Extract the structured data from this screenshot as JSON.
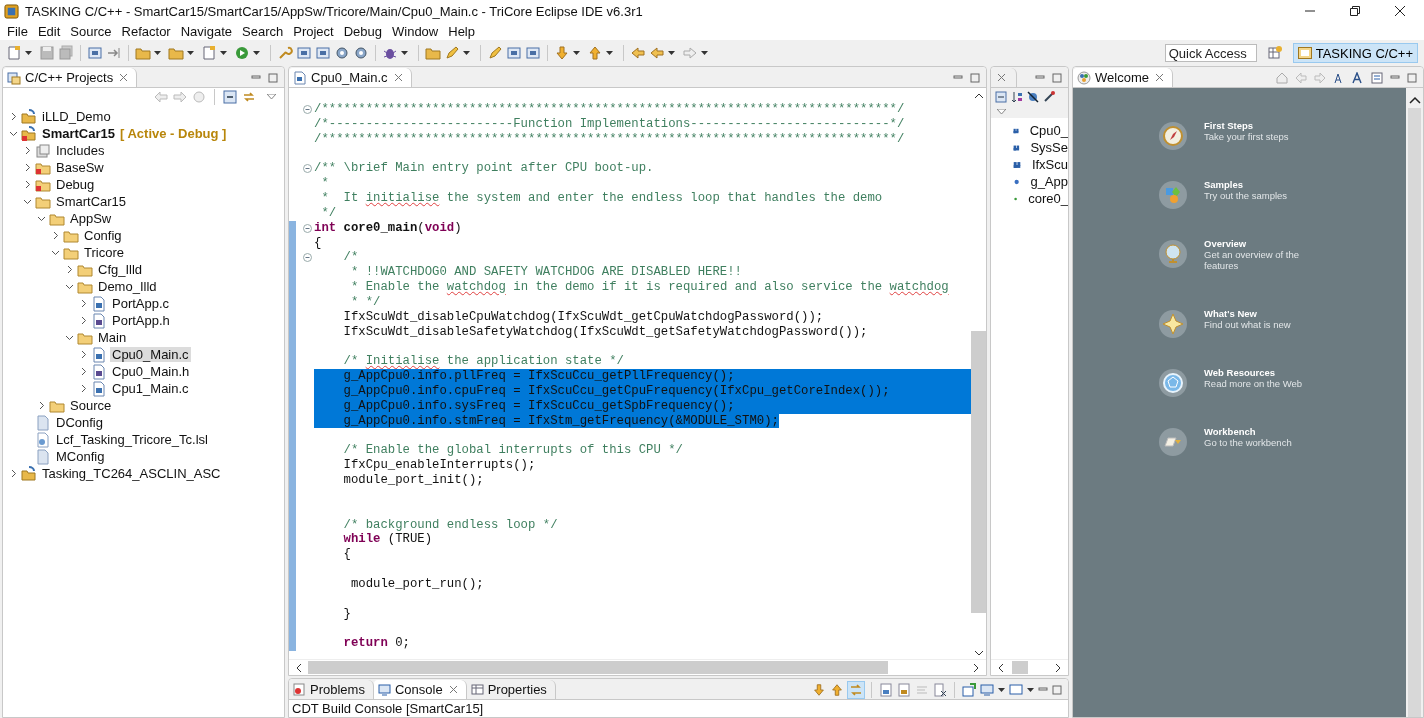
{
  "window": {
    "title": "TASKING C/C++ - SmartCar15/SmartCar15/AppSw/Tricore/Main/Cpu0_Main.c - TriCore Eclipse IDE v6.3r1"
  },
  "menu": [
    "File",
    "Edit",
    "Source",
    "Refactor",
    "Navigate",
    "Search",
    "Project",
    "Debug",
    "Window",
    "Help"
  ],
  "quick_access": {
    "placeholder": "Quick Access"
  },
  "perspectives": [
    {
      "label": "TASKING C/C++",
      "selected": true
    }
  ],
  "project_explorer": {
    "title": "C/C++ Projects",
    "tree": [
      {
        "label": "iLLD_Demo",
        "kind": "project",
        "expanded": false,
        "selected": false
      },
      {
        "label": "SmartCar15",
        "suffix": "[ Active - Debug ]",
        "kind": "project-error",
        "expanded": true,
        "selected": false,
        "children": [
          {
            "label": "Includes",
            "kind": "includes",
            "expanded": false,
            "selected": false
          },
          {
            "label": "BaseSw",
            "kind": "folder-error",
            "expanded": false,
            "selected": false
          },
          {
            "label": "Debug",
            "kind": "folder-error",
            "expanded": false,
            "selected": false
          },
          {
            "label": "SmartCar15",
            "kind": "folder",
            "expanded": true,
            "selected": false,
            "children": [
              {
                "label": "AppSw",
                "kind": "folder",
                "expanded": true,
                "selected": false,
                "children": [
                  {
                    "label": "Config",
                    "kind": "folder",
                    "expanded": false,
                    "selected": false
                  },
                  {
                    "label": "Tricore",
                    "kind": "folder",
                    "expanded": true,
                    "selected": false,
                    "children": [
                      {
                        "label": "Cfg_Illd",
                        "kind": "folder",
                        "expanded": false,
                        "selected": false
                      },
                      {
                        "label": "Demo_Illd",
                        "kind": "folder",
                        "expanded": true,
                        "selected": false,
                        "children": [
                          {
                            "label": "PortApp.c",
                            "kind": "c-file",
                            "expanded": false,
                            "selected": false
                          },
                          {
                            "label": "PortApp.h",
                            "kind": "h-file",
                            "expanded": false,
                            "selected": false
                          }
                        ]
                      },
                      {
                        "label": "Main",
                        "kind": "folder",
                        "expanded": true,
                        "selected": false,
                        "children": [
                          {
                            "label": "Cpu0_Main.c",
                            "kind": "c-file",
                            "expanded": false,
                            "selected": true
                          },
                          {
                            "label": "Cpu0_Main.h",
                            "kind": "h-file",
                            "expanded": false,
                            "selected": false
                          },
                          {
                            "label": "Cpu1_Main.c",
                            "kind": "c-file",
                            "expanded": false,
                            "selected": false
                          }
                        ]
                      }
                    ]
                  }
                ]
              },
              {
                "label": "Source",
                "kind": "folder",
                "expanded": false,
                "selected": false
              }
            ]
          },
          {
            "label": "DConfig",
            "kind": "file",
            "selected": false
          },
          {
            "label": "Lcf_Tasking_Tricore_Tc.lsl",
            "kind": "linker-file",
            "selected": false
          },
          {
            "label": "MConfig",
            "kind": "file",
            "selected": false
          }
        ]
      },
      {
        "label": "Tasking_TC264_ASCLIN_ASC",
        "kind": "project",
        "expanded": false,
        "selected": false
      }
    ]
  },
  "editor": {
    "tab": {
      "label": "Cpu0_Main.c",
      "selected": true
    },
    "lines": [
      {
        "selected": false,
        "fold": true,
        "in_range": false,
        "segments": [
          {
            "text": "/******************************************************************************/",
            "kind": "comment"
          }
        ]
      },
      {
        "selected": false,
        "fold": false,
        "in_range": false,
        "segments": [
          {
            "text": "/*-------------------------Function Implementations---------------------------*/",
            "kind": "comment"
          }
        ]
      },
      {
        "selected": false,
        "fold": false,
        "in_range": false,
        "segments": [
          {
            "text": "/******************************************************************************/",
            "kind": "comment"
          }
        ]
      },
      {
        "selected": false,
        "fold": false,
        "in_range": false
      },
      {
        "selected": false,
        "fold": true,
        "in_range": false,
        "segments": [
          {
            "text": "/** \\brief Main entry point after CPU boot-up.",
            "kind": "comment"
          }
        ]
      },
      {
        "selected": false,
        "fold": false,
        "in_range": false,
        "segments": [
          {
            "text": " *",
            "kind": "comment"
          }
        ]
      },
      {
        "selected": false,
        "fold": false,
        "in_range": false,
        "segments": [
          {
            "text": " *  It ",
            "kind": "comment"
          },
          {
            "text": "initialise",
            "kind": "misspelled"
          },
          {
            "text": " the system and enter the endless loop that handles the demo",
            "kind": "comment"
          }
        ]
      },
      {
        "selected": false,
        "fold": false,
        "in_range": false,
        "segments": [
          {
            "text": " */",
            "kind": "comment"
          }
        ]
      },
      {
        "selected": false,
        "fold": true,
        "in_range": true,
        "segments": [
          {
            "text": "int",
            "kind": "keyword"
          },
          {
            "text": " core0_main",
            "kind": "bold"
          },
          {
            "text": "(",
            "kind": "plain"
          },
          {
            "text": "void",
            "kind": "keyword"
          },
          {
            "text": ")",
            "kind": "plain"
          }
        ]
      },
      {
        "selected": false,
        "fold": false,
        "in_range": true,
        "segments": [
          {
            "text": "{",
            "kind": "plain"
          }
        ]
      },
      {
        "selected": false,
        "fold": true,
        "in_range": true,
        "segments": [
          {
            "text": "    /*",
            "kind": "comment"
          }
        ]
      },
      {
        "selected": false,
        "fold": false,
        "in_range": true,
        "segments": [
          {
            "text": "     * !!WATCHDOG0 AND SAFETY WATCHDOG ARE DISABLED HERE!!",
            "kind": "comment"
          }
        ]
      },
      {
        "selected": false,
        "fold": false,
        "in_range": true,
        "segments": [
          {
            "text": "     * Enable the ",
            "kind": "comment"
          },
          {
            "text": "watchdog",
            "kind": "misspelled"
          },
          {
            "text": " in the demo if it is required and also service the ",
            "kind": "comment"
          },
          {
            "text": "watchdog",
            "kind": "misspelled"
          }
        ]
      },
      {
        "selected": false,
        "fold": false,
        "in_range": true,
        "segments": [
          {
            "text": "     * */",
            "kind": "comment"
          }
        ]
      },
      {
        "selected": false,
        "fold": false,
        "in_range": true,
        "segments": [
          {
            "text": "    IfxScuWdt_disableCpuWatchdog(IfxScuWdt_getCpuWatchdogPassword());",
            "kind": "plain"
          }
        ]
      },
      {
        "selected": false,
        "fold": false,
        "in_range": true,
        "segments": [
          {
            "text": "    IfxScuWdt_disableSafetyWatchdog(IfxScuWdt_getSafetyWatchdogPassword());",
            "kind": "plain"
          }
        ]
      },
      {
        "selected": false,
        "fold": false,
        "in_range": true
      },
      {
        "selected": false,
        "fold": false,
        "in_range": true,
        "segments": [
          {
            "text": "    /* ",
            "kind": "comment"
          },
          {
            "text": "Initialise",
            "kind": "misspelled"
          },
          {
            "text": " the application state */",
            "kind": "comment"
          }
        ]
      },
      {
        "selected": true,
        "fold": false,
        "in_range": true,
        "segments": [
          {
            "text": "    g_AppCpu0.info.pllFreq = IfxScuCcu_getPllFrequency();",
            "kind": "plain"
          }
        ]
      },
      {
        "selected": true,
        "fold": false,
        "in_range": true,
        "segments": [
          {
            "text": "    g_AppCpu0.info.cpuFreq = IfxScuCcu_getCpuFrequency(IfxCpu_getCoreIndex());",
            "kind": "plain"
          }
        ]
      },
      {
        "selected": true,
        "fold": false,
        "in_range": true,
        "segments": [
          {
            "text": "    g_AppCpu0.info.sysFreq = IfxScuCcu_getSpbFrequency();",
            "kind": "plain"
          }
        ]
      },
      {
        "selected": true,
        "fold": false,
        "in_range": true,
        "segments": [
          {
            "text": "    g_AppCpu0.info.stmFreq = IfxStm_getFrequency(&MODULE_STM0);",
            "kind": "plain"
          }
        ]
      },
      {
        "selected": false,
        "fold": false,
        "in_range": true
      },
      {
        "selected": false,
        "fold": false,
        "in_range": true,
        "segments": [
          {
            "text": "    /* Enable the global interrupts of this CPU */",
            "kind": "comment"
          }
        ]
      },
      {
        "selected": false,
        "fold": false,
        "in_range": true,
        "segments": [
          {
            "text": "    IfxCpu_enableInterrupts();",
            "kind": "plain"
          }
        ]
      },
      {
        "selected": false,
        "fold": false,
        "in_range": true,
        "segments": [
          {
            "text": "    module_port_init();",
            "kind": "plain"
          }
        ]
      },
      {
        "selected": false,
        "fold": false,
        "in_range": true
      },
      {
        "selected": false,
        "fold": false,
        "in_range": true
      },
      {
        "selected": false,
        "fold": false,
        "in_range": true,
        "segments": [
          {
            "text": "    /* background endless loop */",
            "kind": "comment"
          }
        ]
      },
      {
        "selected": false,
        "fold": false,
        "in_range": true,
        "segments": [
          {
            "text": "    while",
            "kind": "keyword"
          },
          {
            "text": " (TRUE)",
            "kind": "plain"
          }
        ]
      },
      {
        "selected": false,
        "fold": false,
        "in_range": true,
        "segments": [
          {
            "text": "    {",
            "kind": "plain"
          }
        ]
      },
      {
        "selected": false,
        "fold": false,
        "in_range": true
      },
      {
        "selected": false,
        "fold": false,
        "in_range": true,
        "segments": [
          {
            "text": "     module_port_run();",
            "kind": "plain"
          }
        ]
      },
      {
        "selected": false,
        "fold": false,
        "in_range": true
      },
      {
        "selected": false,
        "fold": false,
        "in_range": true,
        "segments": [
          {
            "text": "    }",
            "kind": "plain"
          }
        ]
      },
      {
        "selected": false,
        "fold": false,
        "in_range": true
      },
      {
        "selected": false,
        "fold": false,
        "in_range": true,
        "segments": [
          {
            "text": "    return",
            "kind": "keyword"
          },
          {
            "text": " 0;",
            "kind": "plain"
          }
        ]
      }
    ]
  },
  "outline": {
    "items": [
      {
        "label": "Cpu0_",
        "kind": "include"
      },
      {
        "label": "SysSe",
        "kind": "include"
      },
      {
        "label": "IfxScu",
        "kind": "include"
      },
      {
        "label": "g_App",
        "kind": "variable"
      },
      {
        "label": "core0_",
        "kind": "function"
      }
    ]
  },
  "welcome": {
    "title": "Welcome",
    "items": [
      {
        "title": "First Steps",
        "description": "Take your first steps",
        "kind": "compass"
      },
      {
        "title": "Samples",
        "description": "Try out the samples",
        "kind": "samples"
      },
      {
        "title": "Overview",
        "description": "Get an overview of the features",
        "kind": "globe"
      },
      {
        "title": "What's New",
        "description": "Find out what is new",
        "kind": "star"
      },
      {
        "title": "Web Resources",
        "description": "Read more on the Web",
        "kind": "web"
      },
      {
        "title": "Workbench",
        "description": "Go to the workbench",
        "kind": "workbench"
      }
    ]
  },
  "bottom_panel": {
    "tabs": [
      {
        "label": "Problems",
        "selected": false
      },
      {
        "label": "Console",
        "selected": true
      },
      {
        "label": "Properties",
        "selected": false
      }
    ],
    "console_title": "CDT Build Console [SmartCar15]"
  }
}
